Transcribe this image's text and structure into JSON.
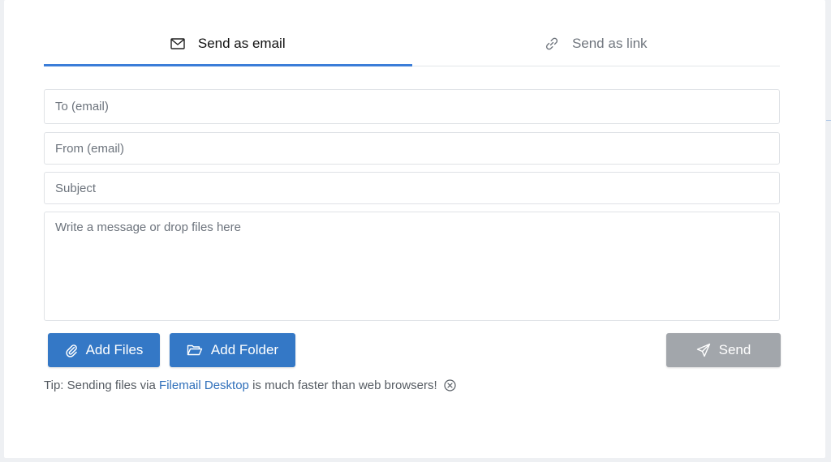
{
  "tabs": {
    "email_label": "Send as email",
    "link_label": "Send as link",
    "active": "email"
  },
  "form": {
    "to_placeholder": "To (email)",
    "from_placeholder": "From (email)",
    "subject_placeholder": "Subject",
    "message_placeholder": "Write a message or drop files here",
    "to_value": "",
    "from_value": "",
    "subject_value": "",
    "message_value": ""
  },
  "buttons": {
    "add_files_label": "Add Files",
    "add_folder_label": "Add Folder",
    "send_label": "Send"
  },
  "tip": {
    "prefix": "Tip: Sending files via",
    "link_text": "Filemail Desktop",
    "suffix": "is much faster than web browsers!"
  },
  "icons": {
    "email_tab": "envelope-icon",
    "link_tab": "link-icon",
    "add_files": "paperclip-icon",
    "add_folder": "folder-open-icon",
    "send": "paper-plane-icon",
    "tip_close": "close-circle-icon"
  },
  "colors": {
    "accent": "#3478c6",
    "tab_underline": "#3b7dd8",
    "disabled": "#a2a6ab",
    "link": "#2f6fba"
  }
}
